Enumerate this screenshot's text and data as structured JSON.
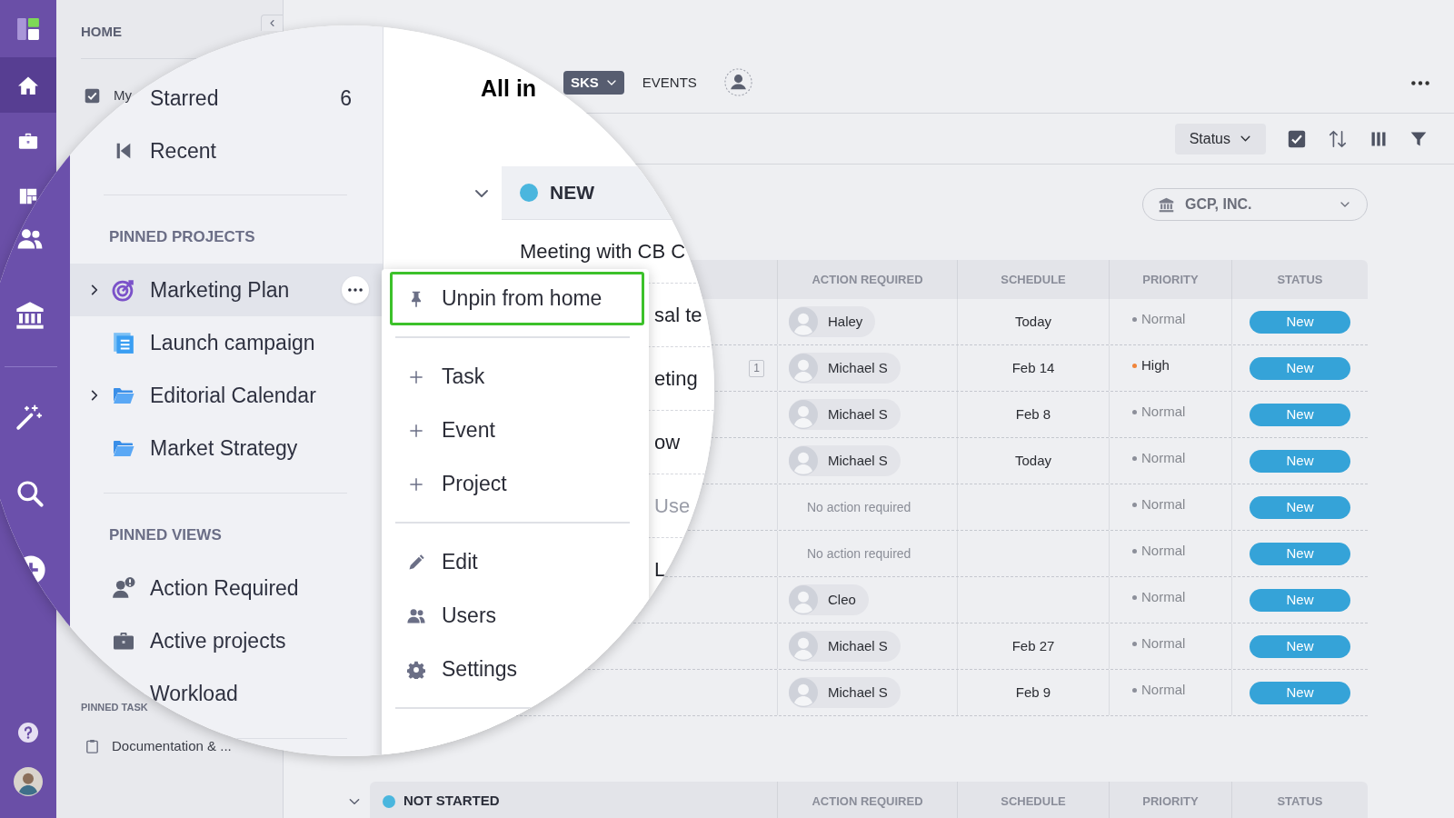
{
  "rail": {
    "items": [
      {
        "selected": true
      },
      {
        "selected": false
      },
      {
        "selected": false
      }
    ]
  },
  "sidebar": {
    "heading": "HOME",
    "items": [
      {
        "label": "My",
        "checked": true
      }
    ],
    "pinned_tasks": {
      "heading": "PINNED TASK",
      "items": [
        {
          "label": "Documentation & ..."
        }
      ]
    }
  },
  "header": {
    "tabs": [
      {
        "label": "SKS",
        "selected": true
      },
      {
        "label": "EVENTS",
        "selected": false
      }
    ]
  },
  "toolbar": {
    "group_by": "Status"
  },
  "company_filter": {
    "value": "GCP, INC."
  },
  "table": {
    "columns": [
      "ACTION REQUIRED",
      "SCHEDULE",
      "PRIORITY",
      "STATUS"
    ],
    "rows": [
      {
        "action": {
          "kind": "person",
          "name": "Haley"
        },
        "schedule": "Today",
        "priority": {
          "label": "Normal",
          "color": "#8c8f9a",
          "urgent": false
        },
        "status": "New"
      },
      {
        "subtasks": "1",
        "action": {
          "kind": "person",
          "name": "Michael S"
        },
        "schedule": "Feb 14",
        "priority": {
          "label": "High",
          "color": "#f0843a",
          "urgent": true
        },
        "status": "New"
      },
      {
        "action": {
          "kind": "person",
          "name": "Michael S"
        },
        "schedule": "Feb 8",
        "priority": {
          "label": "Normal",
          "color": "#8c8f9a",
          "urgent": false
        },
        "status": "New"
      },
      {
        "action": {
          "kind": "person",
          "name": "Michael S"
        },
        "schedule": "Today",
        "priority": {
          "label": "Normal",
          "color": "#8c8f9a",
          "urgent": false
        },
        "status": "New"
      },
      {
        "action": {
          "kind": "none",
          "text": "No action required"
        },
        "priority": {
          "label": "Normal",
          "color": "#8c8f9a",
          "urgent": false
        },
        "status": "New"
      },
      {
        "action": {
          "kind": "none",
          "text": "No action required"
        },
        "priority": {
          "label": "Normal",
          "color": "#8c8f9a",
          "urgent": false
        },
        "status": "New"
      },
      {
        "action": {
          "kind": "person",
          "name": "Cleo"
        },
        "priority": {
          "label": "Normal",
          "color": "#8c8f9a",
          "urgent": false
        },
        "status": "New"
      },
      {
        "action": {
          "kind": "person",
          "name": "Michael S"
        },
        "schedule": "Feb 27",
        "priority": {
          "label": "Normal",
          "color": "#8c8f9a",
          "urgent": false
        },
        "status": "New"
      },
      {
        "action": {
          "kind": "person",
          "name": "Michael S"
        },
        "schedule": "Feb 9",
        "priority": {
          "label": "Normal",
          "color": "#8c8f9a",
          "urgent": false
        },
        "status": "New"
      }
    ]
  },
  "next_group": {
    "title": "NOT STARTED",
    "color": "#4ab6de",
    "expanded": true,
    "columns": [
      "ACTION REQUIRED",
      "SCHEDULE",
      "PRIORITY",
      "STATUS"
    ]
  },
  "magnifier": {
    "sidebar": {
      "items": [
        {
          "label": "Starred",
          "count": "6",
          "selected": false
        },
        {
          "label": "Recent",
          "selected": false
        }
      ],
      "sections": [
        {
          "title": "PINNED PROJECTS",
          "items": [
            {
              "label": "Marketing Plan",
              "expanded": false,
              "selected": true
            },
            {
              "label": "Launch campaign",
              "selected": false
            },
            {
              "label": "Editorial Calendar",
              "expanded": false,
              "selected": false
            },
            {
              "label": "Market Strategy",
              "selected": false
            }
          ]
        },
        {
          "title": "PINNED VIEWS",
          "items": [
            {
              "label": "Action Required",
              "selected": false
            },
            {
              "label": "Active projects",
              "selected": false
            },
            {
              "label": "Workload",
              "selected": false
            }
          ]
        }
      ]
    },
    "main": {
      "title": "All in",
      "group": {
        "title": "NEW",
        "color": "#4ab6de",
        "expanded": true
      },
      "rows": [
        {
          "text": "Meeting with CB C",
          "muted": false
        },
        {
          "text": "sal te",
          "muted": false
        },
        {
          "text": "eting",
          "muted": false
        },
        {
          "text": "ow",
          "muted": false
        },
        {
          "text": "Use",
          "muted": true
        },
        {
          "text": "L",
          "muted": false
        }
      ]
    },
    "menu": {
      "groups": [
        [
          {
            "label": "Unpin from home",
            "selected": true
          }
        ],
        [
          {
            "label": "Task",
            "selected": false
          },
          {
            "label": "Event",
            "selected": false
          },
          {
            "label": "Project",
            "selected": false
          }
        ],
        [
          {
            "label": "Edit",
            "selected": false
          },
          {
            "label": "Users",
            "selected": false
          },
          {
            "label": "Settings",
            "selected": false
          }
        ]
      ]
    }
  }
}
